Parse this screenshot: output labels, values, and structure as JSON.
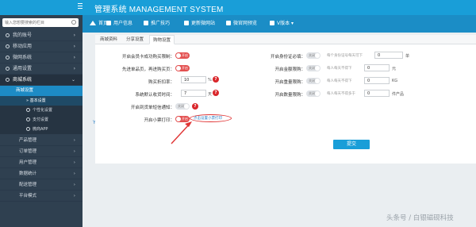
{
  "header": {
    "title": "管理系统 MANAGEMENT SYSTEM"
  },
  "sidebar": {
    "search_placeholder": "输入您想要搜索的栏目",
    "items": [
      {
        "label": "我的账号"
      },
      {
        "label": "移动应用"
      },
      {
        "label": "微网系统"
      },
      {
        "label": "通用设置"
      },
      {
        "label": "商城系统"
      }
    ],
    "submenu": {
      "label": "商城设置"
    },
    "subsub": [
      {
        "label": "基本设置"
      },
      {
        "label": "个性化设置"
      },
      {
        "label": "支付设置"
      },
      {
        "label": "微商APP"
      }
    ],
    "children": [
      {
        "label": "产品管理"
      },
      {
        "label": "订单管理"
      },
      {
        "label": "用户管理"
      },
      {
        "label": "数据统计"
      },
      {
        "label": "配送管理"
      },
      {
        "label": "平台模式"
      }
    ]
  },
  "nav": {
    "items": [
      {
        "label": "首页",
        "icon": "home-icon"
      },
      {
        "label": "用户信息",
        "icon": "user-icon"
      },
      {
        "label": "推广技巧",
        "icon": "promo-icon"
      },
      {
        "label": "更新微网站",
        "icon": "refresh-icon"
      },
      {
        "label": "微官网预览",
        "icon": "eye-icon"
      },
      {
        "label": "V版本",
        "icon": "version-icon"
      }
    ]
  },
  "tabs": [
    {
      "label": "商城资料"
    },
    {
      "label": "分享设置"
    },
    {
      "label": "购物设置",
      "active": true
    }
  ],
  "form": {
    "left": [
      {
        "label": "开启会员卡成功购买限制：",
        "toggle": "on",
        "toggle_text": "开启"
      },
      {
        "label": "先进单品页，再进购买页：",
        "toggle": "on",
        "toggle_text": "开启"
      },
      {
        "label": "购买折扣率：",
        "value": "10",
        "unit": "%"
      },
      {
        "label": "系统默认收货时间：",
        "value": "7",
        "unit": "天"
      },
      {
        "label": "开启到货单短信通知：",
        "toggle": "off",
        "toggle_text": "关闭"
      },
      {
        "label": "开启小票打印：",
        "toggle": "on",
        "toggle_text": "开启"
      }
    ],
    "right": [
      {
        "label": "开启身份证必填：",
        "toggle": "off",
        "toggle_text": "关闭",
        "hint": "每个身份证号每天可下",
        "value": "0",
        "unit": "单"
      },
      {
        "label": "开启金额限购：",
        "toggle": "off",
        "toggle_text": "关闭",
        "hint": "每人每天不得下",
        "value": "0",
        "unit": "元"
      },
      {
        "label": "开启重量限购：",
        "toggle": "off",
        "toggle_text": "关闭",
        "hint": "每人每天不得下",
        "value": "0",
        "unit": "KG"
      },
      {
        "label": "开启数量限购：",
        "toggle": "off",
        "toggle_text": "关闭",
        "hint": "每人每天不得多于",
        "value": "0",
        "unit": "件产品"
      }
    ],
    "print_link": "点击设置小票打印",
    "submit": "提交"
  },
  "misc": {
    "left_tag": "YU"
  },
  "watermark": "头条号 / 白银磁砚科技"
}
